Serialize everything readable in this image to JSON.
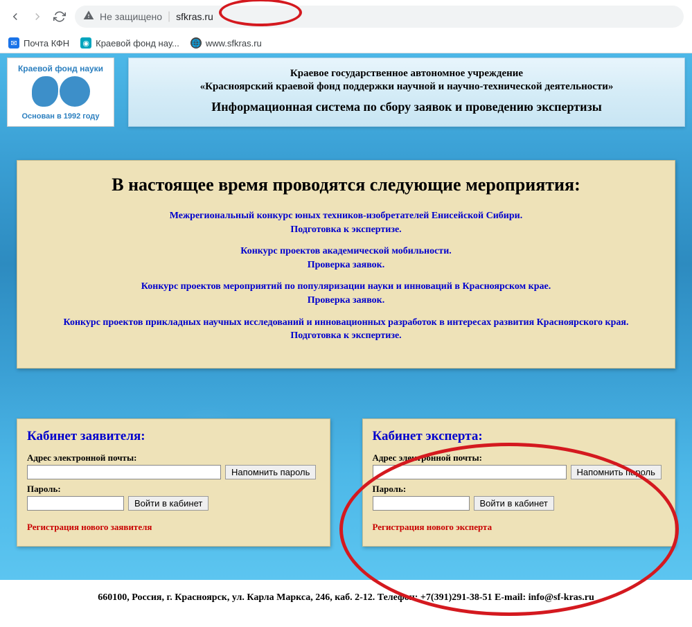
{
  "browser": {
    "insecure_label": "Не защищено",
    "url": "sfkras.ru",
    "bookmarks": [
      {
        "label": "Почта КФН"
      },
      {
        "label": "Краевой фонд нау..."
      },
      {
        "label": "www.sfkras.ru"
      }
    ]
  },
  "logo": {
    "top": "Краевой фонд науки",
    "bottom": "Основан в 1992 году"
  },
  "header": {
    "line1": "Краевое государственное автономное учреждение",
    "line2": "«Красноярский краевой фонд поддержки научной и научно-технической деятельности»",
    "line3": "Информационная система по сбору заявок и проведению экспертизы"
  },
  "events": {
    "title": "В настоящее время проводятся следующие мероприятия:",
    "list": [
      {
        "l1": "Межрегиональный конкурс юных техников-изобретателей Енисейской Сибири.",
        "l2": "Подготовка к экспертизе."
      },
      {
        "l1": "Конкурс проектов академической мобильности.",
        "l2": "Проверка заявок."
      },
      {
        "l1": "Конкурс проектов мероприятий по популяризации науки и инноваций в Красноярском крае.",
        "l2": "Проверка заявок."
      },
      {
        "l1": "Конкурс проектов прикладных научных исследований и инновационных разработок в интересах развития Красноярского края.",
        "l2": "Подготовка к экспертизе."
      }
    ]
  },
  "login": {
    "applicant": {
      "title": "Кабинет заявителя:",
      "email_label": "Адрес электронной почты:",
      "remind_btn": "Напомнить пароль",
      "password_label": "Пароль:",
      "enter_btn": "Войти в кабинет",
      "reg_link": "Регистрация нового заявителя"
    },
    "expert": {
      "title": "Кабинет эксперта:",
      "email_label": "Адрес электронной почты:",
      "remind_btn": "Напомнить пароль",
      "password_label": "Пароль:",
      "enter_btn": "Войти в кабинет",
      "reg_link": "Регистрация нового эксперта"
    }
  },
  "footer": {
    "text": "660100, Россия, г. Красноярск, ул. Карла Маркса, 246, каб. 2-12. Телефон: +7(391)291-38-51 E-mail: info@sf-kras.ru"
  }
}
